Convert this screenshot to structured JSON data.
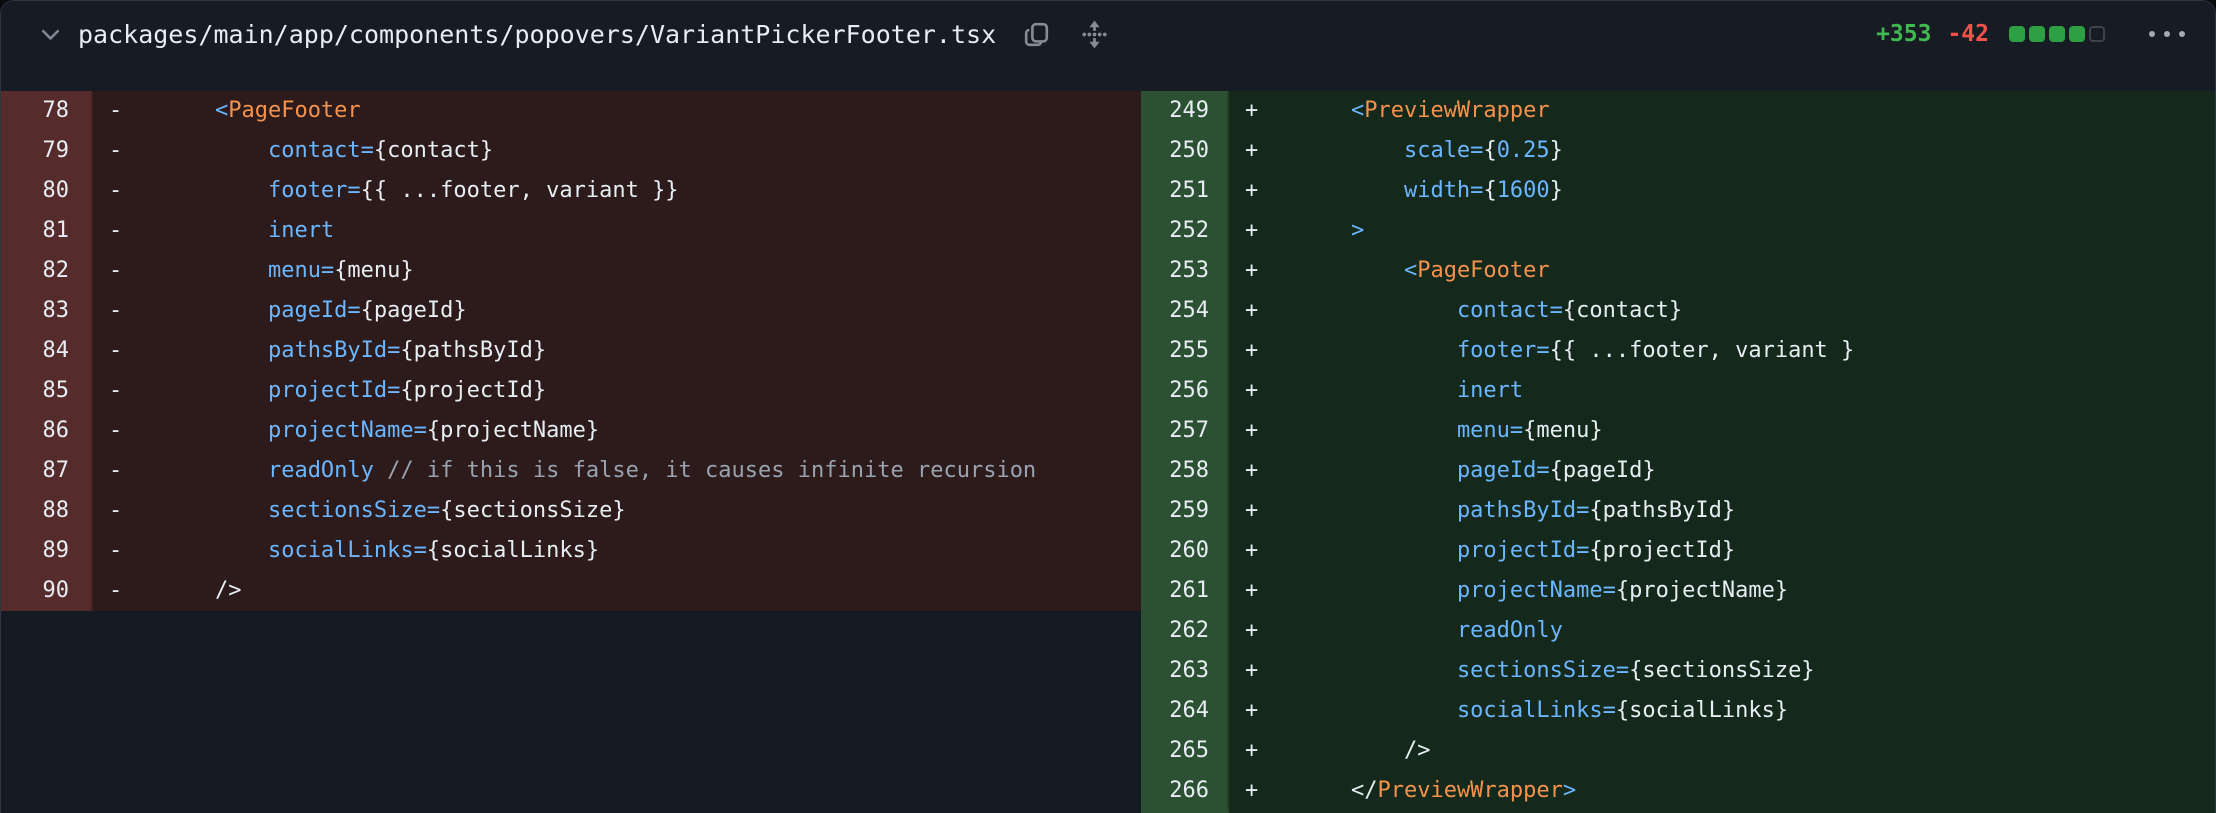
{
  "header": {
    "file_path": "packages/main/app/components/popovers/VariantPickerFooter.tsx",
    "additions": "+353",
    "deletions": "-42",
    "change_blocks": {
      "filled": 4,
      "total": 5
    },
    "icons": [
      "chevron-down",
      "copy",
      "expand-vertical",
      "ellipsis-menu"
    ]
  },
  "theme": {
    "page_bg": "#0A0B0D",
    "header_bg": "#171B23",
    "card_border": "#2E3641",
    "empty_bg": "#141922",
    "del_gutter_bg": "#552B2B",
    "del_code_bg": "#2C1B1A",
    "add_gutter_bg": "#2B5132",
    "add_code_bg": "#14291B",
    "tok_blue": "#6CB6FF",
    "tok_orange": "#F5924D",
    "tok_plain": "#E6EDF3",
    "tok_comment": "#99A3B0",
    "num_color": "#E8EDF3",
    "stat_green": "#3FB950",
    "stat_red": "#F85149",
    "block_green": "#2EA043",
    "block_empty_border": "#3C434D",
    "icon_gray": "#848D97",
    "path_color": "#E7EDF3"
  },
  "diff": {
    "left": {
      "kind": "deleted",
      "lines": [
        {
          "num": 78,
          "sign": "-",
          "indent": 8,
          "segments": [
            {
              "text": "<",
              "color": "blue"
            },
            {
              "text": "PageFooter",
              "color": "orange"
            }
          ]
        },
        {
          "num": 79,
          "sign": "-",
          "indent": 12,
          "segments": [
            {
              "text": "contact=",
              "color": "blue"
            },
            {
              "text": "{contact}",
              "color": "plain"
            }
          ]
        },
        {
          "num": 80,
          "sign": "-",
          "indent": 12,
          "segments": [
            {
              "text": "footer=",
              "color": "blue"
            },
            {
              "text": "{{ ...footer, variant }}",
              "color": "plain"
            }
          ]
        },
        {
          "num": 81,
          "sign": "-",
          "indent": 12,
          "segments": [
            {
              "text": "inert",
              "color": "blue"
            }
          ]
        },
        {
          "num": 82,
          "sign": "-",
          "indent": 12,
          "segments": [
            {
              "text": "menu=",
              "color": "blue"
            },
            {
              "text": "{menu}",
              "color": "plain"
            }
          ]
        },
        {
          "num": 83,
          "sign": "-",
          "indent": 12,
          "segments": [
            {
              "text": "pageId=",
              "color": "blue"
            },
            {
              "text": "{pageId}",
              "color": "plain"
            }
          ]
        },
        {
          "num": 84,
          "sign": "-",
          "indent": 12,
          "segments": [
            {
              "text": "pathsById=",
              "color": "blue"
            },
            {
              "text": "{pathsById}",
              "color": "plain"
            }
          ]
        },
        {
          "num": 85,
          "sign": "-",
          "indent": 12,
          "segments": [
            {
              "text": "projectId=",
              "color": "blue"
            },
            {
              "text": "{projectId}",
              "color": "plain"
            }
          ]
        },
        {
          "num": 86,
          "sign": "-",
          "indent": 12,
          "segments": [
            {
              "text": "projectName=",
              "color": "blue"
            },
            {
              "text": "{projectName}",
              "color": "plain"
            }
          ]
        },
        {
          "num": 87,
          "sign": "-",
          "indent": 12,
          "segments": [
            {
              "text": "readOnly",
              "color": "blue"
            },
            {
              "text": " // if this is false, it causes infinite recursion",
              "color": "comment"
            }
          ]
        },
        {
          "num": 88,
          "sign": "-",
          "indent": 12,
          "segments": [
            {
              "text": "sectionsSize=",
              "color": "blue"
            },
            {
              "text": "{sectionsSize}",
              "color": "plain"
            }
          ]
        },
        {
          "num": 89,
          "sign": "-",
          "indent": 12,
          "segments": [
            {
              "text": "socialLinks=",
              "color": "blue"
            },
            {
              "text": "{socialLinks}",
              "color": "plain"
            }
          ]
        },
        {
          "num": 90,
          "sign": "-",
          "indent": 8,
          "segments": [
            {
              "text": "/>",
              "color": "plain"
            }
          ]
        }
      ]
    },
    "right": {
      "kind": "added",
      "lines": [
        {
          "num": 249,
          "sign": "+",
          "indent": 8,
          "segments": [
            {
              "text": "<",
              "color": "blue"
            },
            {
              "text": "PreviewWrapper",
              "color": "orange"
            }
          ]
        },
        {
          "num": 250,
          "sign": "+",
          "indent": 12,
          "segments": [
            {
              "text": "scale=",
              "color": "blue"
            },
            {
              "text": "{",
              "color": "plain"
            },
            {
              "text": "0.25",
              "color": "blue"
            },
            {
              "text": "}",
              "color": "plain"
            }
          ]
        },
        {
          "num": 251,
          "sign": "+",
          "indent": 12,
          "segments": [
            {
              "text": "width=",
              "color": "blue"
            },
            {
              "text": "{",
              "color": "plain"
            },
            {
              "text": "1600",
              "color": "blue"
            },
            {
              "text": "}",
              "color": "plain"
            }
          ]
        },
        {
          "num": 252,
          "sign": "+",
          "indent": 8,
          "segments": [
            {
              "text": ">",
              "color": "blue"
            }
          ]
        },
        {
          "num": 253,
          "sign": "+",
          "indent": 12,
          "segments": [
            {
              "text": "<",
              "color": "blue"
            },
            {
              "text": "PageFooter",
              "color": "orange"
            }
          ]
        },
        {
          "num": 254,
          "sign": "+",
          "indent": 16,
          "segments": [
            {
              "text": "contact=",
              "color": "blue"
            },
            {
              "text": "{contact}",
              "color": "plain"
            }
          ]
        },
        {
          "num": 255,
          "sign": "+",
          "indent": 16,
          "segments": [
            {
              "text": "footer=",
              "color": "blue"
            },
            {
              "text": "{{ ...footer, variant }",
              "color": "plain"
            }
          ]
        },
        {
          "num": 256,
          "sign": "+",
          "indent": 16,
          "segments": [
            {
              "text": "inert",
              "color": "blue"
            }
          ]
        },
        {
          "num": 257,
          "sign": "+",
          "indent": 16,
          "segments": [
            {
              "text": "menu=",
              "color": "blue"
            },
            {
              "text": "{menu}",
              "color": "plain"
            }
          ]
        },
        {
          "num": 258,
          "sign": "+",
          "indent": 16,
          "segments": [
            {
              "text": "pageId=",
              "color": "blue"
            },
            {
              "text": "{pageId}",
              "color": "plain"
            }
          ]
        },
        {
          "num": 259,
          "sign": "+",
          "indent": 16,
          "segments": [
            {
              "text": "pathsById=",
              "color": "blue"
            },
            {
              "text": "{pathsById}",
              "color": "plain"
            }
          ]
        },
        {
          "num": 260,
          "sign": "+",
          "indent": 16,
          "segments": [
            {
              "text": "projectId=",
              "color": "blue"
            },
            {
              "text": "{projectId}",
              "color": "plain"
            }
          ]
        },
        {
          "num": 261,
          "sign": "+",
          "indent": 16,
          "segments": [
            {
              "text": "projectName=",
              "color": "blue"
            },
            {
              "text": "{projectName}",
              "color": "plain"
            }
          ]
        },
        {
          "num": 262,
          "sign": "+",
          "indent": 16,
          "segments": [
            {
              "text": "readOnly",
              "color": "blue"
            }
          ]
        },
        {
          "num": 263,
          "sign": "+",
          "indent": 16,
          "segments": [
            {
              "text": "sectionsSize=",
              "color": "blue"
            },
            {
              "text": "{sectionsSize}",
              "color": "plain"
            }
          ]
        },
        {
          "num": 264,
          "sign": "+",
          "indent": 16,
          "segments": [
            {
              "text": "socialLinks=",
              "color": "blue"
            },
            {
              "text": "{socialLinks}",
              "color": "plain"
            }
          ]
        },
        {
          "num": 265,
          "sign": "+",
          "indent": 12,
          "segments": [
            {
              "text": "/>",
              "color": "plain"
            }
          ]
        },
        {
          "num": 266,
          "sign": "+",
          "indent": 8,
          "segments": [
            {
              "text": "</",
              "color": "plain"
            },
            {
              "text": "PreviewWrapper",
              "color": "orange"
            },
            {
              "text": ">",
              "color": "blue"
            }
          ]
        }
      ]
    }
  }
}
